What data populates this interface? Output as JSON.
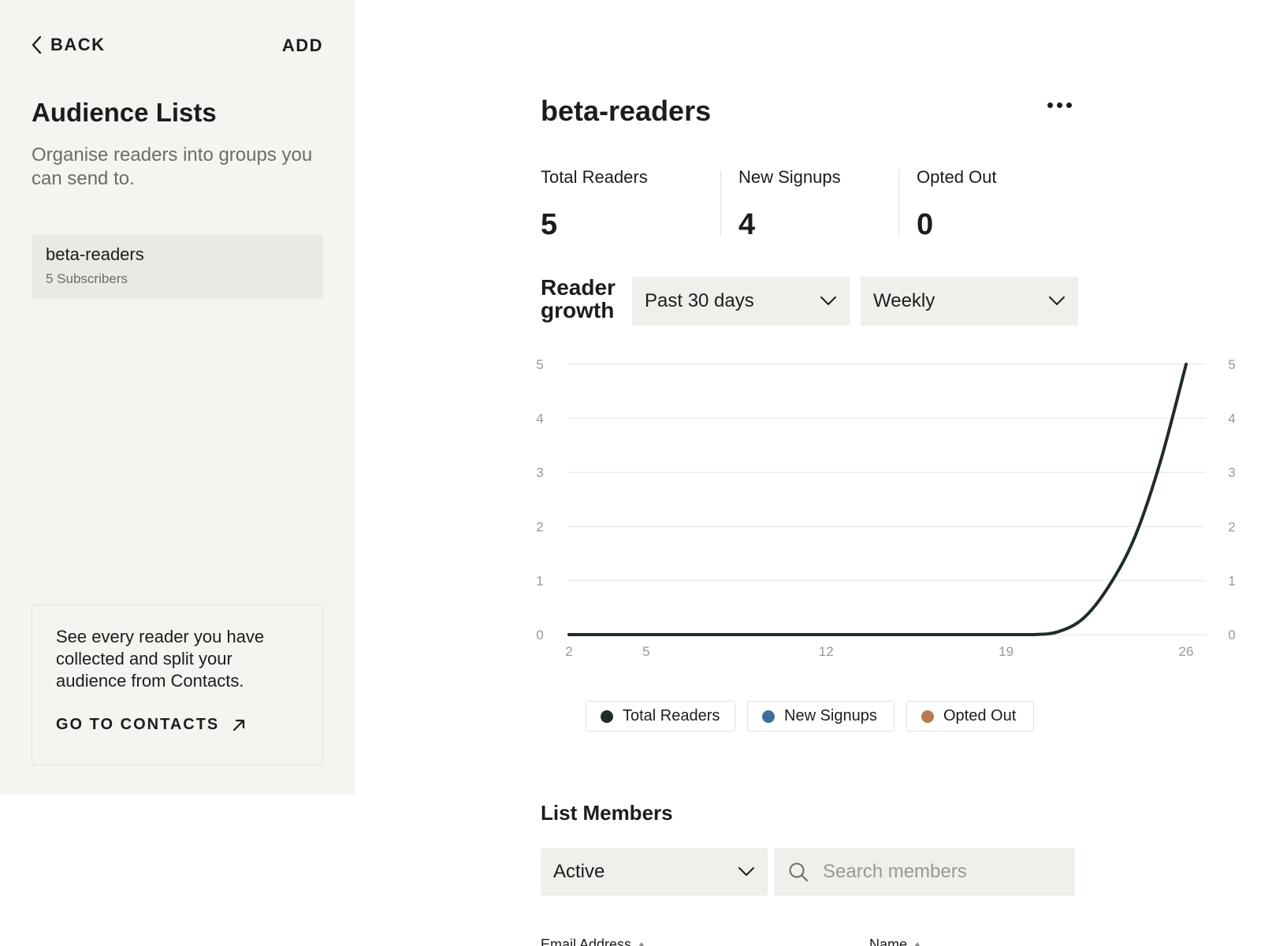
{
  "sidebar": {
    "back_label": "BACK",
    "add_label": "ADD",
    "title": "Audience Lists",
    "description": "Organise readers into groups you can send to.",
    "lists": [
      {
        "name": "beta-readers",
        "count": "5 Subscribers"
      }
    ],
    "info_card": {
      "text": "See every reader you have collected and split your audience from Contacts.",
      "link_label": "GO TO CONTACTS"
    }
  },
  "main": {
    "title": "beta-readers",
    "stats": [
      {
        "label": "Total Readers",
        "value": "5"
      },
      {
        "label": "New Signups",
        "value": "4"
      },
      {
        "label": "Opted Out",
        "value": "0"
      }
    ],
    "growth": {
      "title_line1": "Reader",
      "title_line2": "growth",
      "range_value": "Past 30 days",
      "interval_value": "Weekly"
    },
    "legend": [
      {
        "label": "Total Readers",
        "color": "#1f2d28"
      },
      {
        "label": "New Signups",
        "color": "#3f6e9c"
      },
      {
        "label": "Opted Out",
        "color": "#b97c52"
      }
    ],
    "members": {
      "title": "List Members",
      "status_filter": "Active",
      "search_placeholder": "Search members",
      "columns": [
        "Email Address",
        "Name"
      ]
    }
  },
  "chart_data": {
    "type": "line",
    "x": [
      2,
      5,
      12,
      19,
      20,
      21,
      22,
      23,
      24,
      25,
      26
    ],
    "series": [
      {
        "name": "Total Readers",
        "values": [
          0,
          0,
          0,
          0,
          0,
          0.05,
          0.3,
          0.9,
          1.8,
          3.2,
          5
        ],
        "color": "#1f2d28"
      }
    ],
    "xticks": [
      2,
      5,
      12,
      19,
      26
    ],
    "yticks": [
      0,
      1,
      2,
      3,
      4,
      5
    ],
    "xlim": [
      2,
      26
    ],
    "ylim": [
      0,
      5
    ],
    "right_axis": true,
    "grid": true,
    "legend_position": "bottom"
  }
}
